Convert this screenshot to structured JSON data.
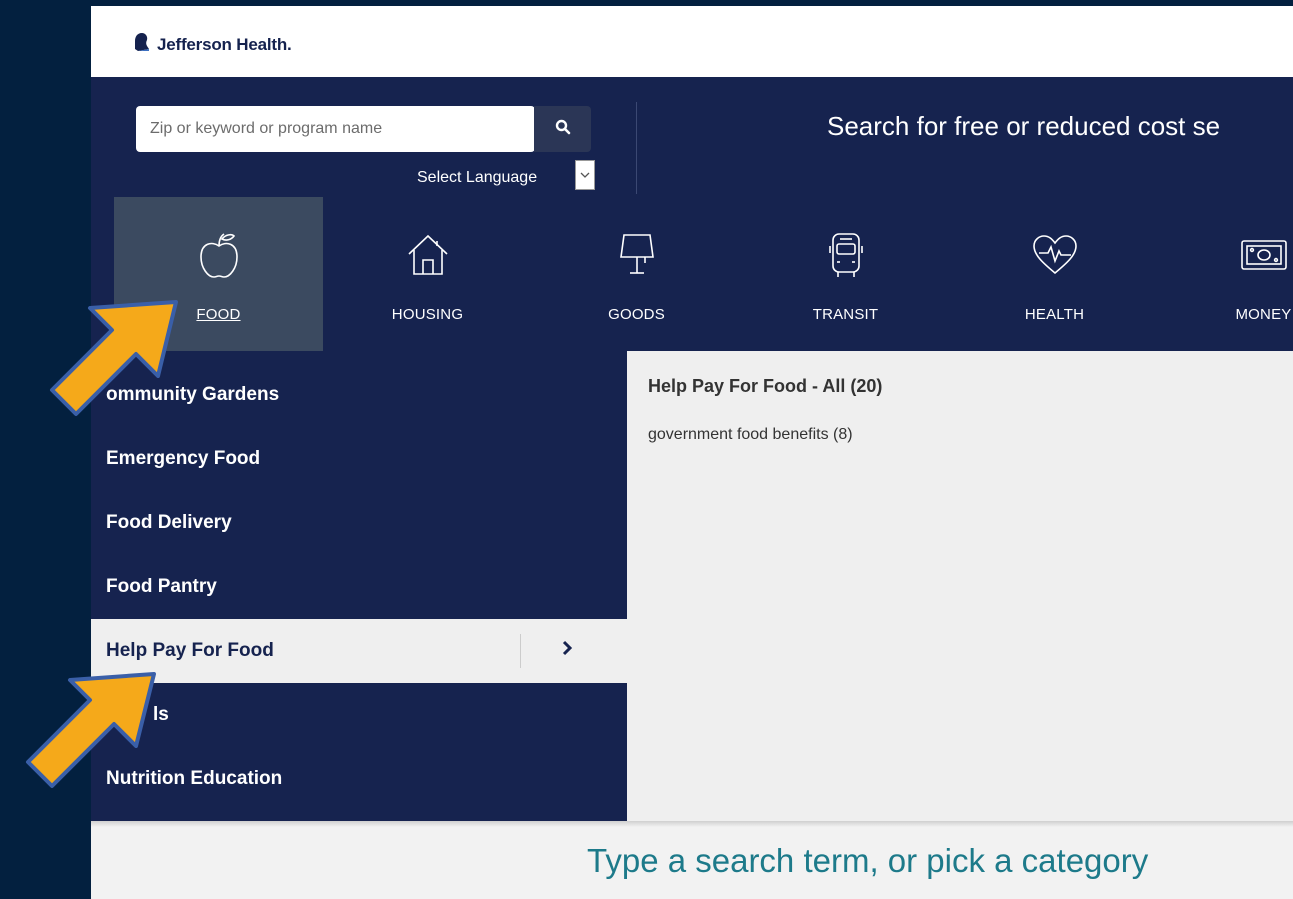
{
  "brand": {
    "name": "Jefferson Health."
  },
  "search": {
    "placeholder": "Zip or keyword or program name",
    "language_label": "Select Language"
  },
  "hero": {
    "title": "Search for free or reduced cost se"
  },
  "categories": [
    {
      "label": "FOOD",
      "icon": "apple-icon",
      "active": true
    },
    {
      "label": "HOUSING",
      "icon": "house-icon"
    },
    {
      "label": "GOODS",
      "icon": "lamp-icon"
    },
    {
      "label": "TRANSIT",
      "icon": "bus-icon"
    },
    {
      "label": "HEALTH",
      "icon": "heart-pulse-icon"
    },
    {
      "label": "MONEY",
      "icon": "money-icon"
    }
  ],
  "subcategories": [
    {
      "label": "ommunity Gardens"
    },
    {
      "label": "Emergency Food"
    },
    {
      "label": "Food Delivery"
    },
    {
      "label": "Food Pantry"
    },
    {
      "label": "Help Pay For Food",
      "active": true
    },
    {
      "label": "ls"
    },
    {
      "label": "Nutrition Education"
    }
  ],
  "detail": {
    "title": "Help Pay For Food - All (20)",
    "links": [
      "government food benefits (8)"
    ]
  },
  "footer_prompt": "Type a search term, or pick a category",
  "colors": {
    "navy": "#16234f",
    "active_tab": "#3b4a60",
    "teal": "#1d7a8a",
    "arrow": "#f5a91a",
    "arrow_outline": "#3a5fa8"
  }
}
